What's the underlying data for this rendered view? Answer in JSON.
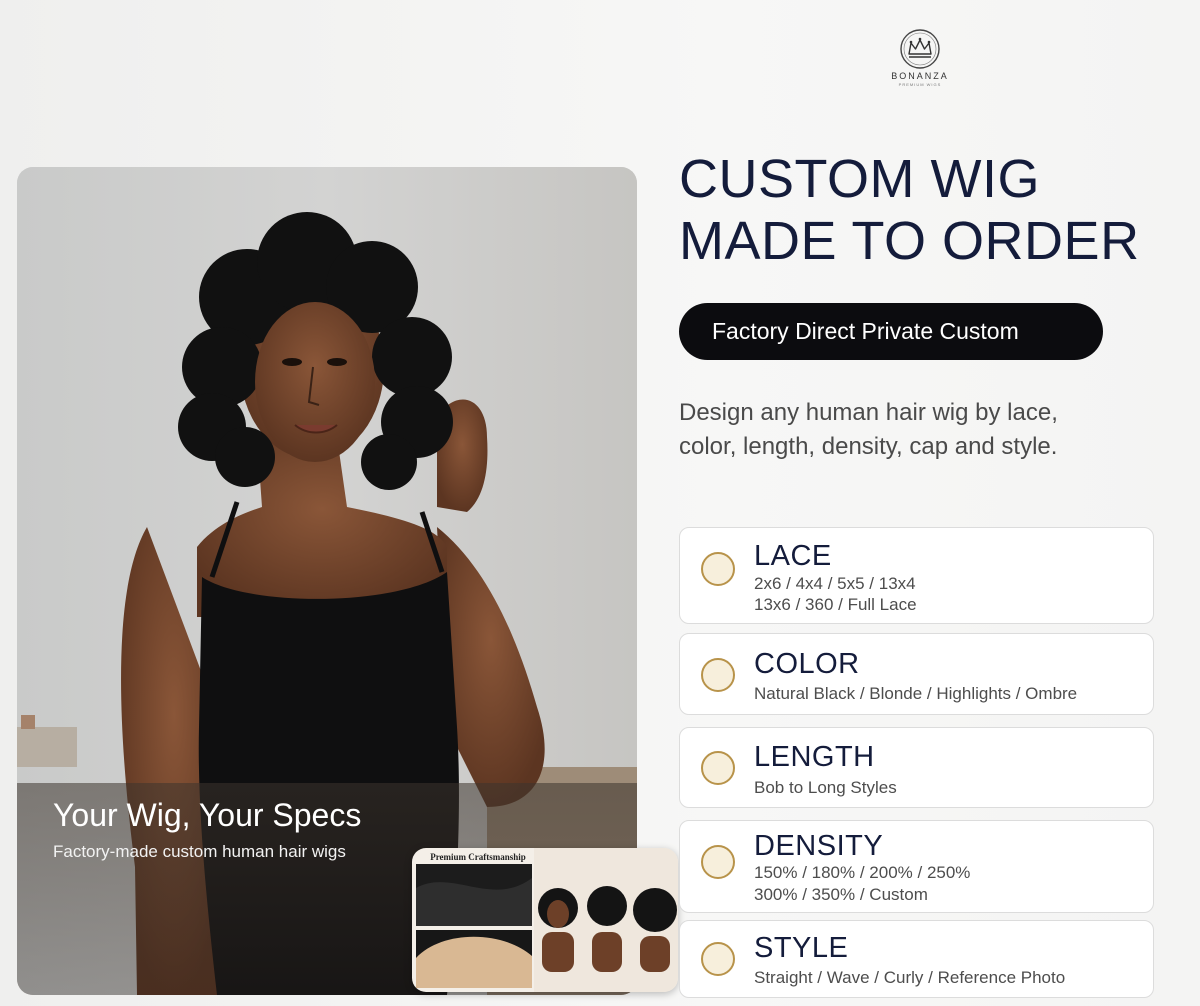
{
  "brand": {
    "name": "BONANZA",
    "tagline": "PREMIUM WIGS"
  },
  "hero": {
    "caption_title": "Your Wig, Your Specs",
    "caption_subtitle": "Factory-made custom human hair wigs",
    "inset_label": "Premium Craftsmanship"
  },
  "headline": {
    "line1": "CUSTOM WIG",
    "line2": "MADE TO ORDER"
  },
  "pill_label": "Factory Direct Private Custom",
  "description": {
    "line1": "Design any human hair wig by lace,",
    "line2": "color, length, density, cap and style."
  },
  "options": [
    {
      "title": "LACE",
      "lines": [
        "2x6 / 4x4 / 5x5 / 13x4",
        "13x6 / 360 / Full Lace"
      ]
    },
    {
      "title": "COLOR",
      "lines": [
        "Natural Black / Blonde / Highlights / Ombre"
      ]
    },
    {
      "title": "LENGTH",
      "lines": [
        "Bob to Long Styles"
      ]
    },
    {
      "title": "DENSITY",
      "lines": [
        "150% / 180% / 200% / 250%",
        "300% / 350% / Custom"
      ]
    },
    {
      "title": "STYLE",
      "lines": [
        "Straight / Wave / Curly / Reference Photo"
      ]
    }
  ],
  "colors": {
    "navy": "#141c3b",
    "pill_bg": "#0c0c0f",
    "accent_gold": "#b8934a"
  },
  "icons": {
    "logo": "crown-icon",
    "option_marker": "circle-icon"
  }
}
